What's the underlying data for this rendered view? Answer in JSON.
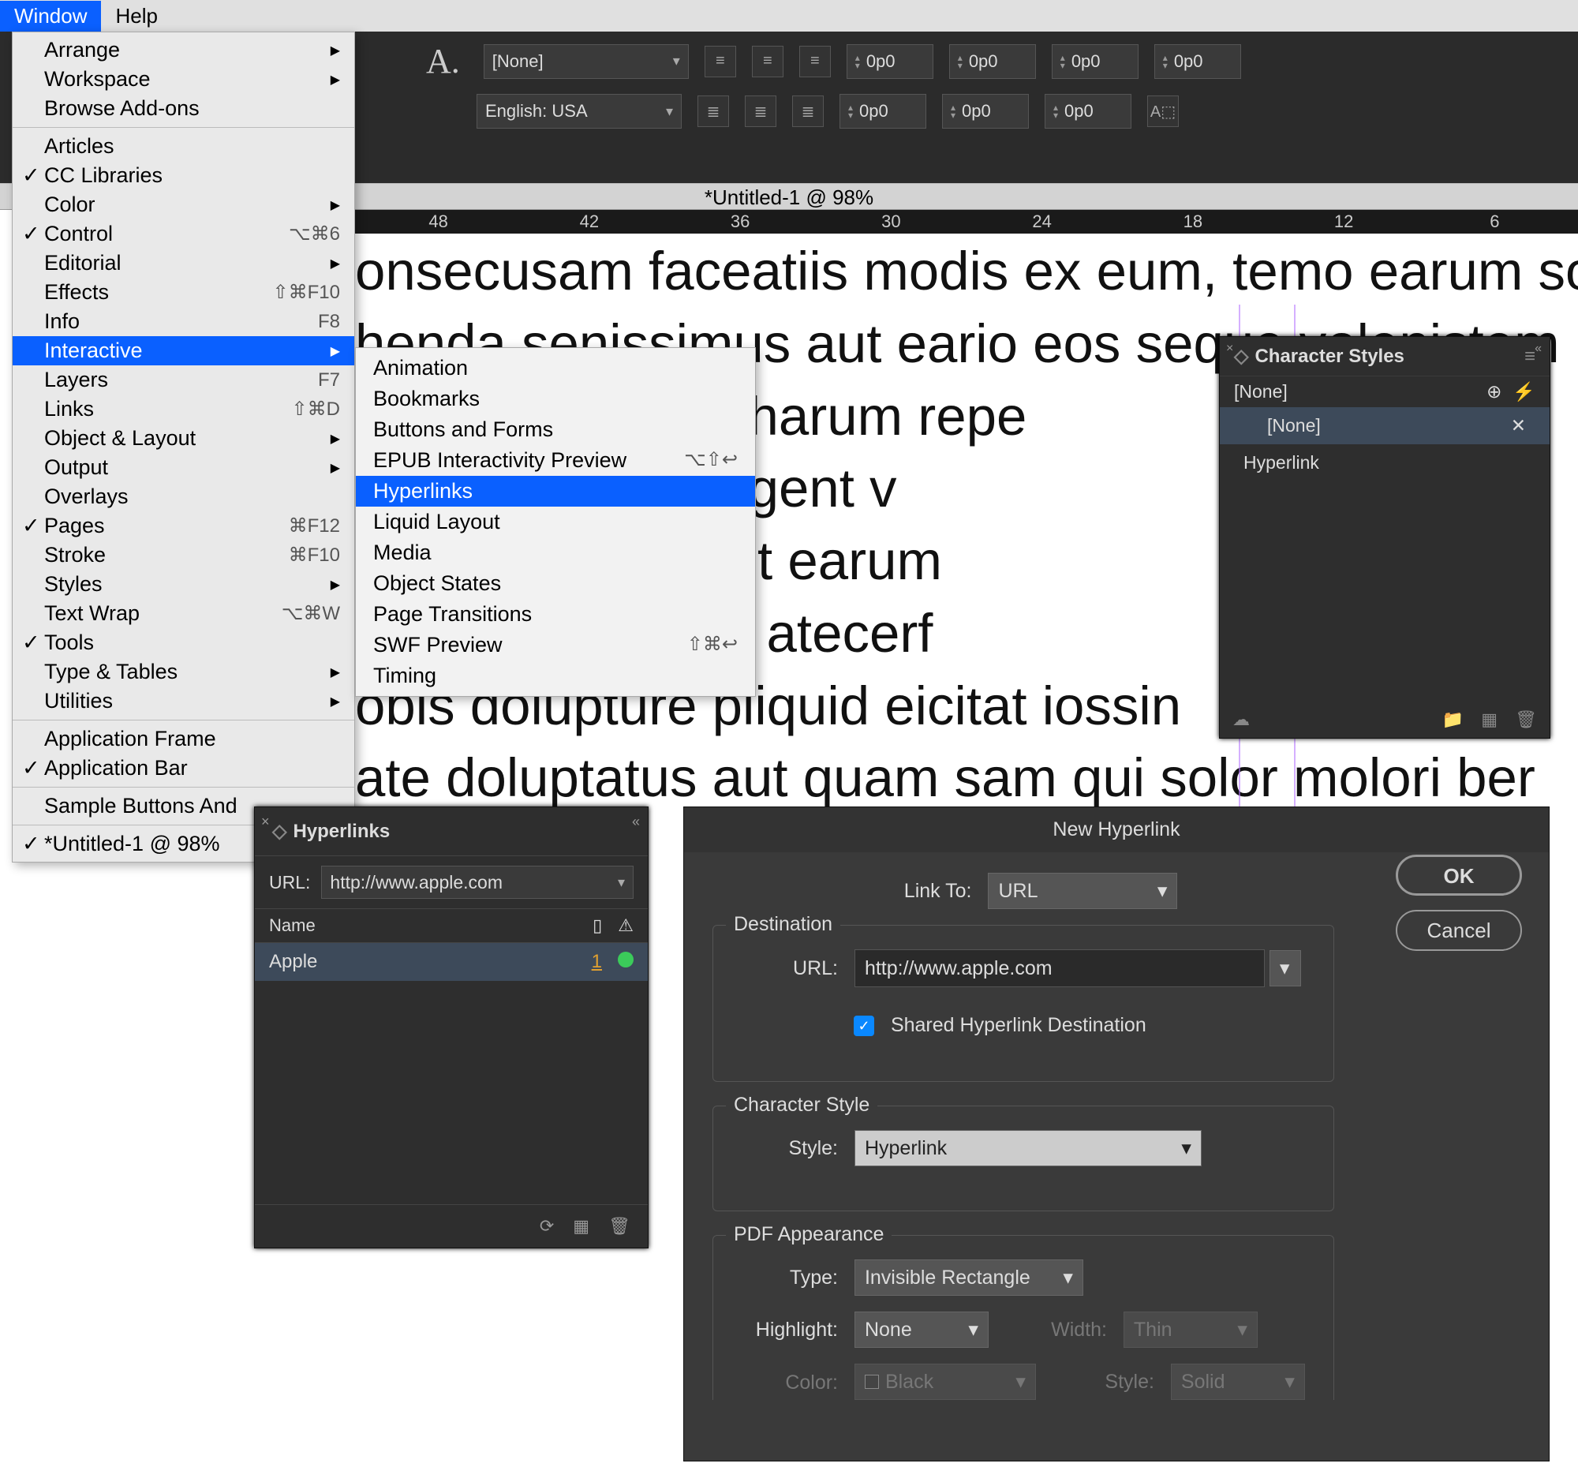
{
  "menubar": {
    "window": "Window",
    "help": "Help"
  },
  "document_tab": "*Untitled-1 @ 98%",
  "topbar": {
    "style_dropdown": "[None]",
    "lang_dropdown": "English: USA",
    "num_value": "0p0"
  },
  "ruler_ticks": [
    "48",
    "42",
    "36",
    "30",
    "24",
    "18",
    "12",
    "6"
  ],
  "doc_lines": [
    "onsecusam faceatiis modis ex eum, temo earum so",
    "henda senissimus aut eario eos seque volenistem",
    "t et et harum repe",
    " modigent v",
    "m sunt es ut earum",
    "em voluptis atecerf",
    "obis dolupture pliquid eicitat iossin",
    "ate doluptatus aut quam sam qui solor molori ber"
  ],
  "hyperlinked_word": "Apple",
  "window_menu": {
    "items": [
      {
        "label": "Arrange",
        "arrow": true
      },
      {
        "label": "Workspace",
        "arrow": true
      },
      {
        "label": "Browse Add-ons"
      },
      {
        "sep": true
      },
      {
        "label": "Articles"
      },
      {
        "label": "CC Libraries",
        "checked": true
      },
      {
        "label": "Color",
        "arrow": true
      },
      {
        "label": "Control",
        "checked": true,
        "shortcut": "⌥⌘6"
      },
      {
        "label": "Editorial",
        "arrow": true
      },
      {
        "label": "Effects",
        "shortcut": "⇧⌘F10"
      },
      {
        "label": "Info",
        "shortcut": "F8"
      },
      {
        "label": "Interactive",
        "arrow": true,
        "selected": true
      },
      {
        "label": "Layers",
        "shortcut": "F7"
      },
      {
        "label": "Links",
        "shortcut": "⇧⌘D"
      },
      {
        "label": "Object & Layout",
        "arrow": true
      },
      {
        "label": "Output",
        "arrow": true
      },
      {
        "label": "Overlays"
      },
      {
        "label": "Pages",
        "checked": true,
        "shortcut": "⌘F12"
      },
      {
        "label": "Stroke",
        "shortcut": "⌘F10"
      },
      {
        "label": "Styles",
        "arrow": true
      },
      {
        "label": "Text Wrap",
        "shortcut": "⌥⌘W"
      },
      {
        "label": "Tools",
        "checked": true
      },
      {
        "label": "Type & Tables",
        "arrow": true
      },
      {
        "label": "Utilities",
        "arrow": true
      },
      {
        "sep": true
      },
      {
        "label": "Application Frame"
      },
      {
        "label": "Application Bar",
        "checked": true
      },
      {
        "sep": true
      },
      {
        "label": "Sample Buttons And"
      },
      {
        "sep": true
      },
      {
        "label": "*Untitled-1 @ 98%",
        "checked": true
      }
    ]
  },
  "submenu": {
    "items": [
      {
        "label": "Animation"
      },
      {
        "label": "Bookmarks"
      },
      {
        "label": "Buttons and Forms"
      },
      {
        "label": "EPUB Interactivity Preview",
        "shortcut": "⌥⇧↩"
      },
      {
        "label": "Hyperlinks",
        "selected": true
      },
      {
        "label": "Liquid Layout"
      },
      {
        "label": "Media"
      },
      {
        "label": "Object States"
      },
      {
        "label": "Page Transitions"
      },
      {
        "label": "SWF Preview",
        "shortcut": "⇧⌘↩"
      },
      {
        "label": "Timing"
      }
    ]
  },
  "hyperlinks_panel": {
    "title": "Hyperlinks",
    "url_label": "URL:",
    "url_value": "http://www.apple.com",
    "col_name": "Name",
    "item_name": "Apple",
    "item_count": "1"
  },
  "char_styles": {
    "title": "Character Styles",
    "none": "[None]",
    "sel": "[None]",
    "hyperlink": "Hyperlink"
  },
  "dialog": {
    "title": "New Hyperlink",
    "ok": "OK",
    "cancel": "Cancel",
    "linkto_label": "Link To:",
    "linkto_value": "URL",
    "dest_title": "Destination",
    "url_label": "URL:",
    "url_value": "http://www.apple.com",
    "shared": "Shared Hyperlink Destination",
    "cstyle_title": "Character Style",
    "style_label": "Style:",
    "style_value": "Hyperlink",
    "pdf_title": "PDF Appearance",
    "type_label": "Type:",
    "type_value": "Invisible Rectangle",
    "highlight_label": "Highlight:",
    "highlight_value": "None",
    "width_label": "Width:",
    "width_value": "Thin",
    "color_label": "Color:",
    "color_value": "Black",
    "style2_label": "Style:",
    "style2_value": "Solid"
  }
}
